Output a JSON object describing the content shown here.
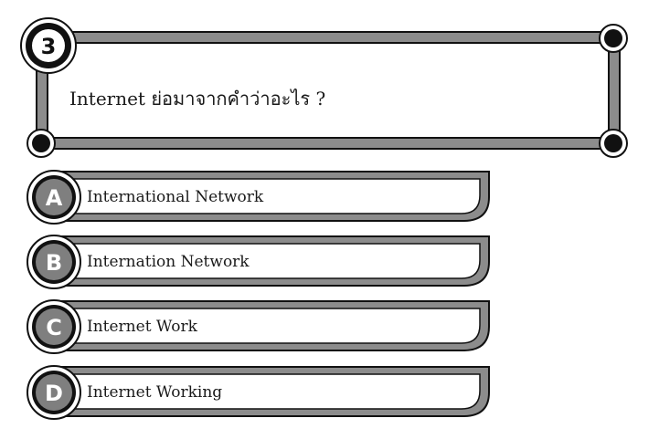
{
  "question": {
    "number": "3",
    "text": "Internet ย่อมาจากคำว่าอะไร ?"
  },
  "options": [
    {
      "letter": "A",
      "label": "International Network"
    },
    {
      "letter": "B",
      "label": "Internation Network"
    },
    {
      "letter": "C",
      "label": "Internet Work"
    },
    {
      "letter": "D",
      "label": "Internet Working"
    }
  ],
  "colors": {
    "frame_gray": "#8c8c8c",
    "outline": "#111111",
    "badge_fill": "#7f7f7f",
    "background": "#ffffff"
  }
}
